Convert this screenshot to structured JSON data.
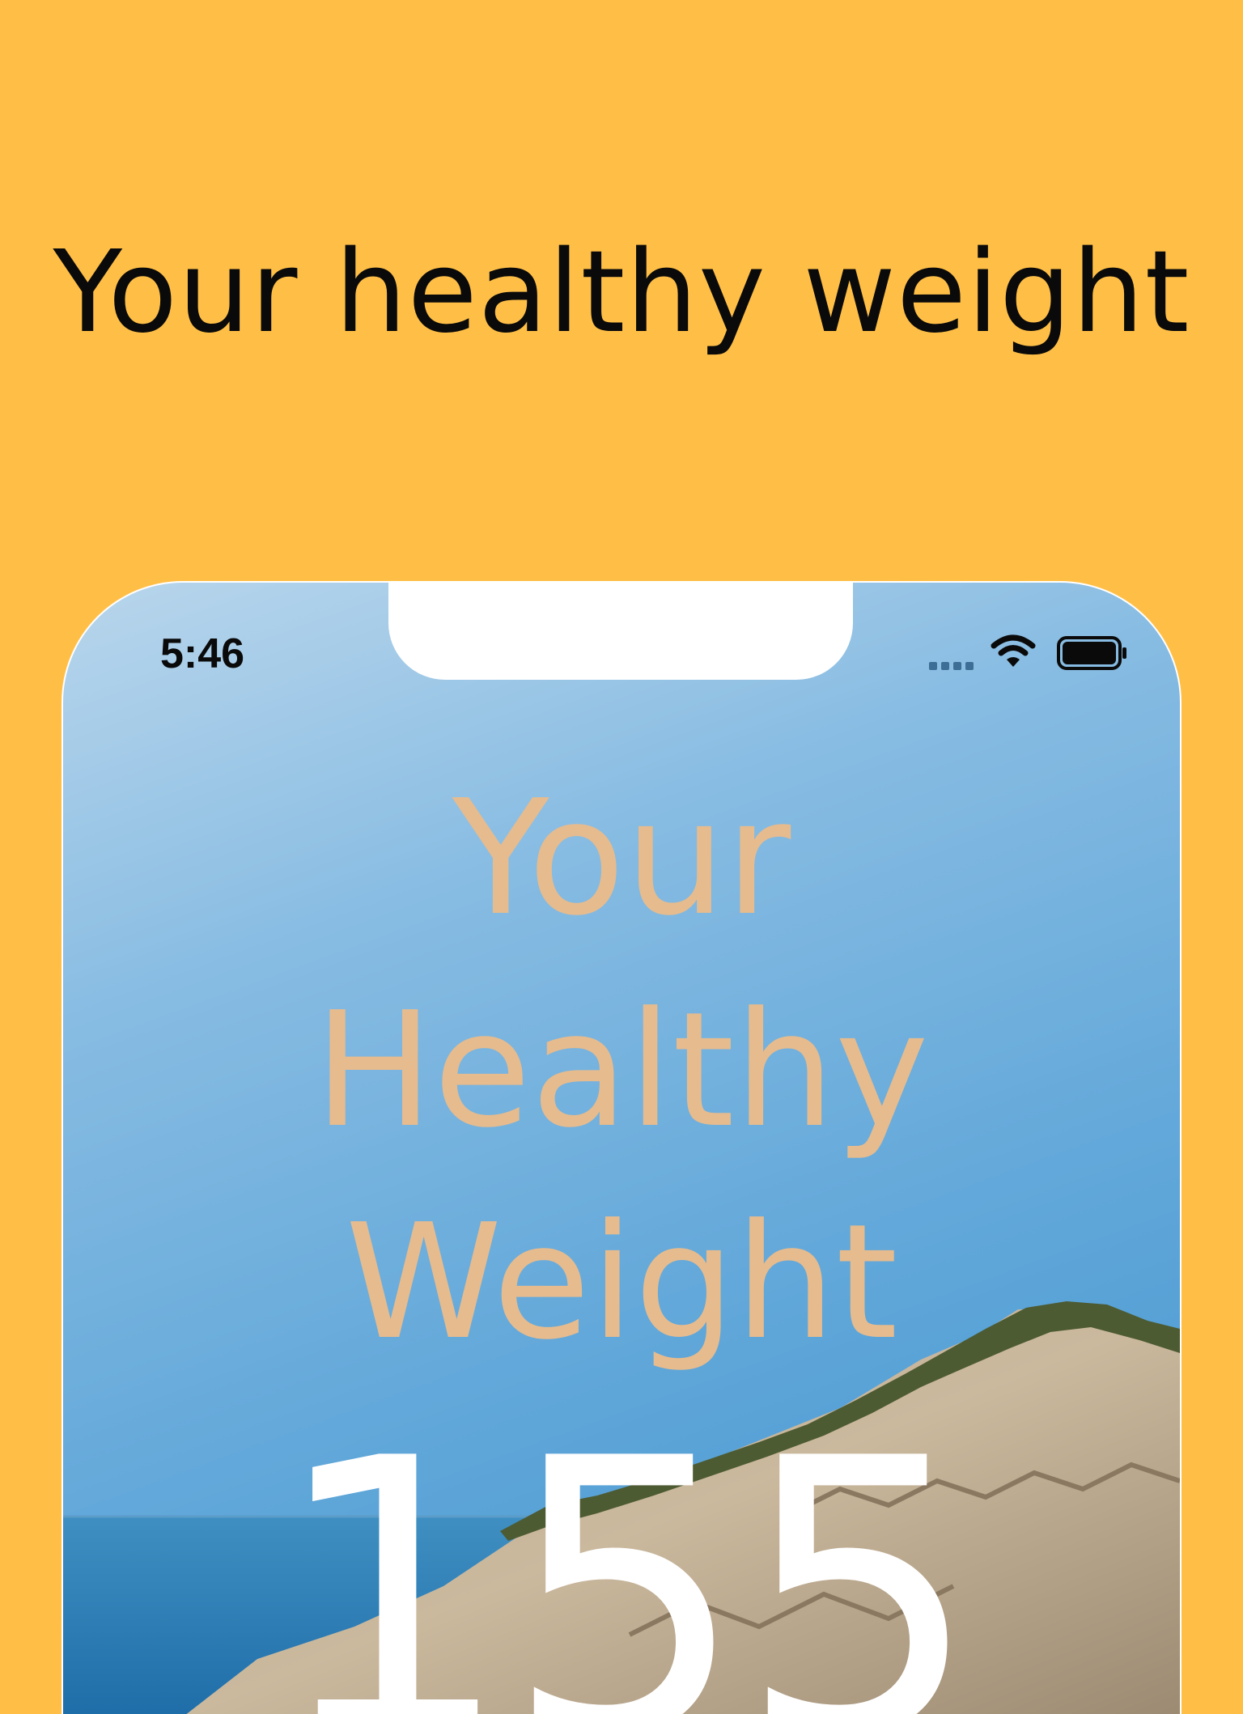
{
  "headline": "Your healthy weight",
  "phone": {
    "status_bar": {
      "time": "5:46",
      "icons": [
        "signal-dots-icon",
        "wifi-icon",
        "battery-icon"
      ]
    },
    "title_lines": [
      "Your",
      "Healthy",
      "Weight"
    ],
    "weight_value": "155"
  },
  "colors": {
    "background": "#FFBF47",
    "title_accent": "#E6BB8E",
    "value_text": "#FFFFFF",
    "headline_text": "#0A0A0A"
  }
}
